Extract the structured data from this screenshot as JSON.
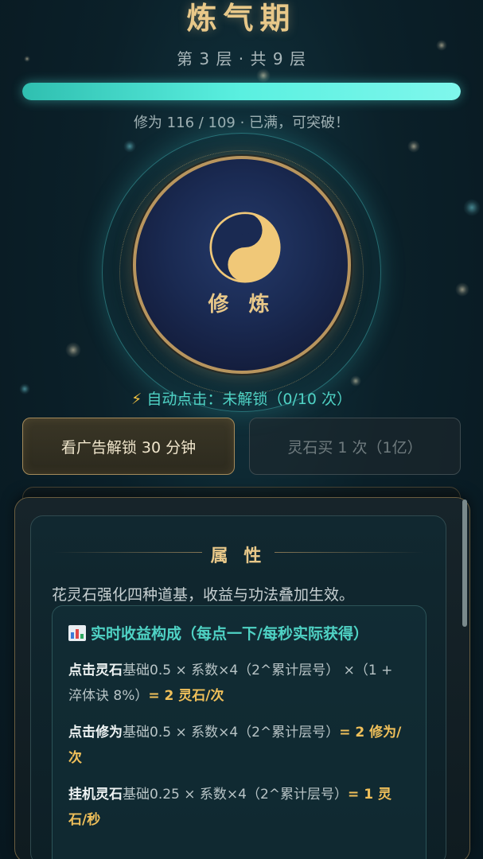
{
  "realm": {
    "name": "炼气期",
    "layer_text": "第 3 层 · 共 9 层",
    "progress": 1.0,
    "cultivation_text": "修为 116 / 109 · 已满，可突破！"
  },
  "orb": {
    "icon": "yin-yang-icon",
    "label": "修 炼"
  },
  "auto_click": {
    "icon": "lightning-icon",
    "text": "自动点击：未解锁（0/10 次）"
  },
  "buttons": {
    "ad_unlock": "看广告解锁 30 分钟",
    "stone_buy": "灵石买 1 次（1亿）"
  },
  "panel": {
    "heading": "属 性",
    "description": "花灵石强化四种道基，收益与功法叠加生效。",
    "breakdown": {
      "icon": "bar-chart-icon",
      "title": "实时收益构成（每点一下/每秒实际获得）",
      "rows": [
        {
          "name": "点击灵石",
          "formula": "基础0.5 × 系数×4（2^累计层号） ×（1 + 淬体诀 8%）",
          "result": "= 2 灵石/次"
        },
        {
          "name": "点击修为",
          "formula": "基础0.5 × 系数×4（2^累计层号）",
          "result": "= 2 修为/次"
        },
        {
          "name": "挂机灵石",
          "formula": "基础0.25 × 系数×4（2^累计层号）",
          "result": "= 1 灵石/秒"
        }
      ]
    }
  },
  "colors": {
    "gold": "#e8c889",
    "teal": "#4fd2c4",
    "result": "#f0c05a"
  }
}
